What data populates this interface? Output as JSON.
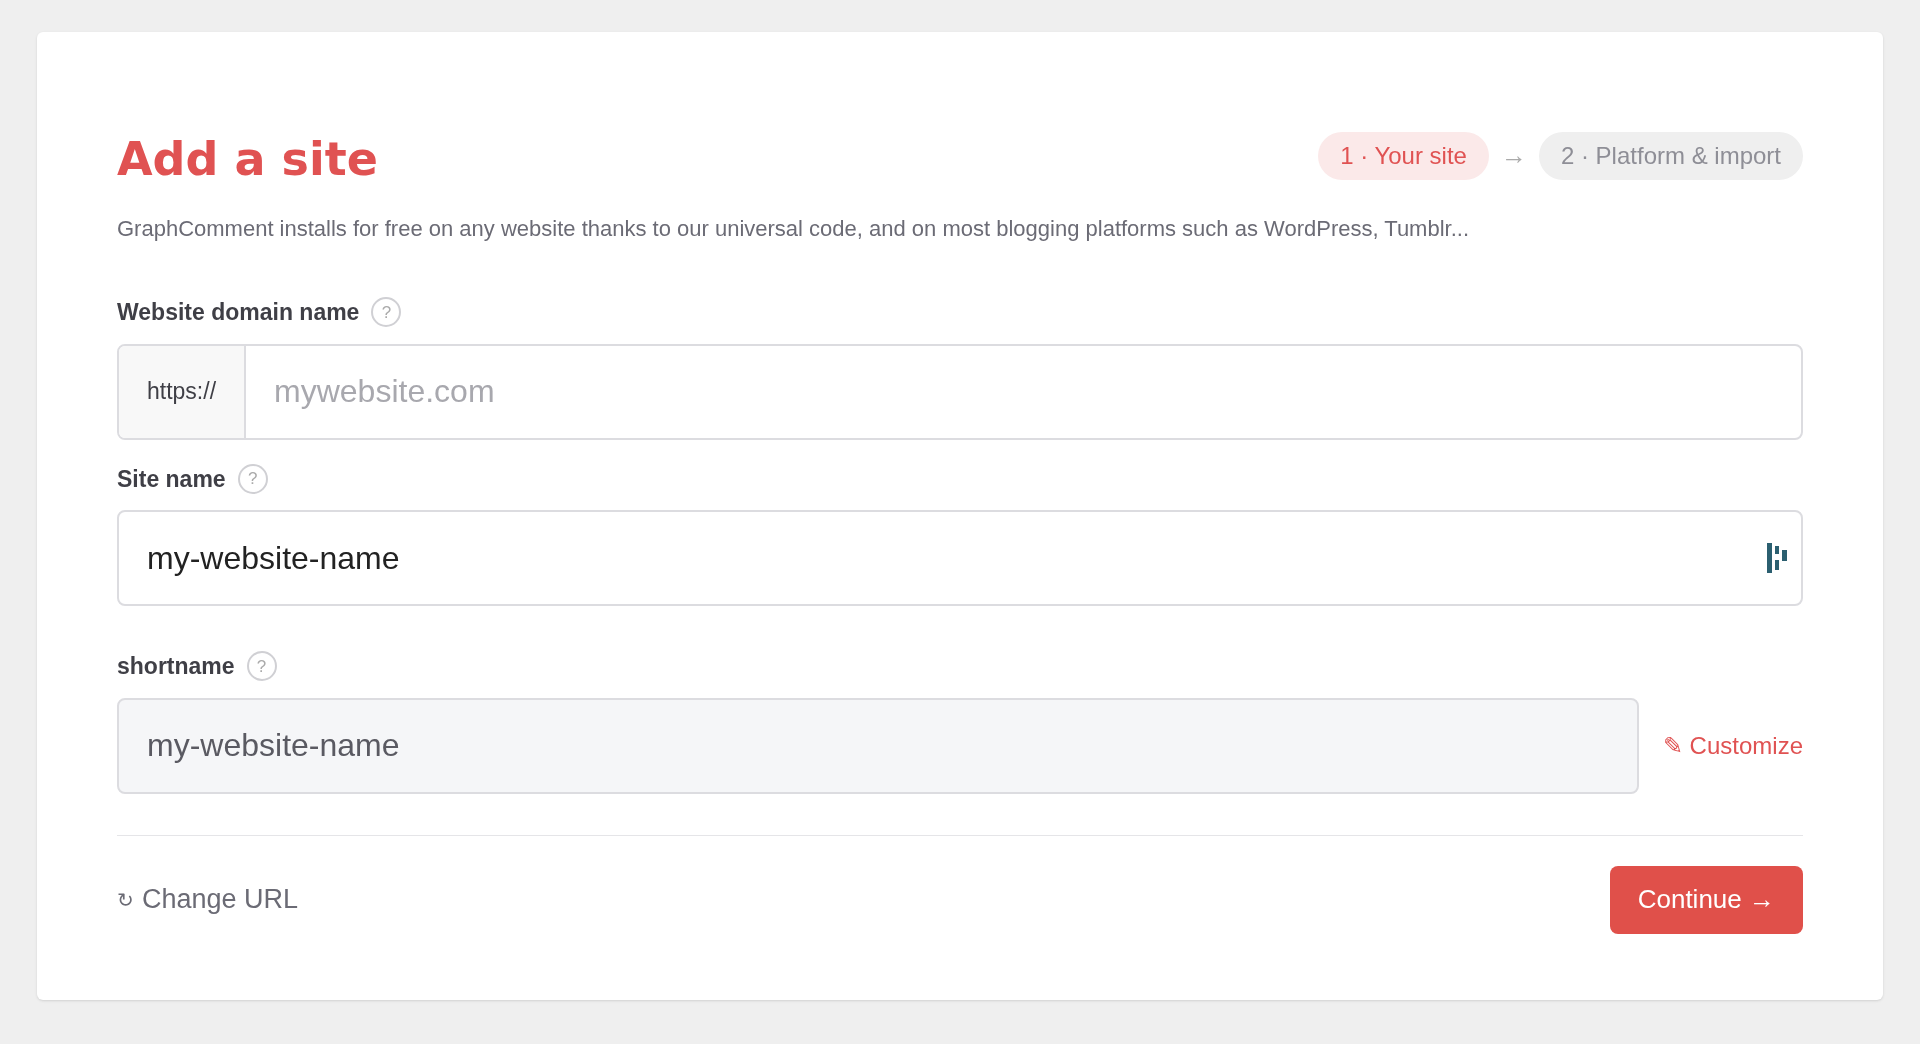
{
  "title": "Add a site",
  "steps": [
    {
      "label": "1 · Your site",
      "selected": true
    },
    {
      "label": "2 · Platform & import",
      "selected": false
    }
  ],
  "step_separator": "→",
  "description": "GraphComment installs for free on any website thanks to our universal code, and on most blogging platforms such as WordPress, Tumblr...",
  "fields": [
    {
      "label": "Website domain name",
      "help": "?",
      "prefix": "https://",
      "placeholder": "mywebsite.com"
    },
    {
      "label": "Site name",
      "help": "?",
      "value": "my-website-name",
      "badge": true
    },
    {
      "label": "shortname",
      "help": "?",
      "value": "my-website-name",
      "disabled": true,
      "action": {
        "icon": "✎",
        "label": "Customize"
      }
    }
  ],
  "footer": {
    "change_url": {
      "icon": "↻",
      "label": "Change URL"
    },
    "continue": "Continue →"
  }
}
